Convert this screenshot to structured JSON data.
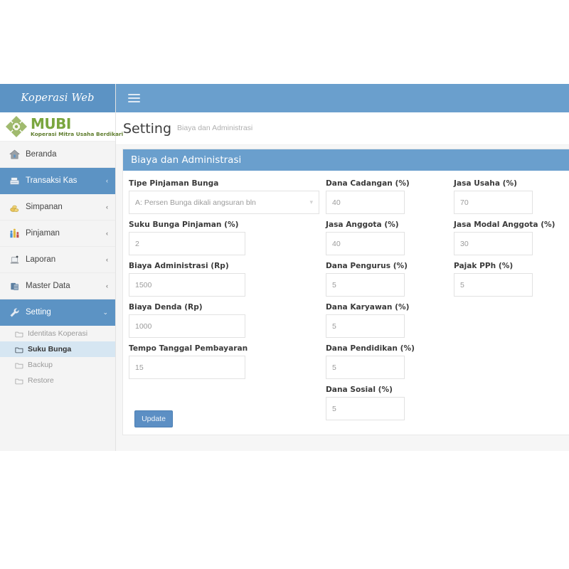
{
  "sidebar": {
    "brand": "Koperasi Web",
    "logo": {
      "icon": "mubi-diamond-logo",
      "word": "MUBI",
      "tagline": "Koperasi Mitra Usaha Berdikari",
      "color": "#7aa63f"
    },
    "items": [
      {
        "label": "Beranda",
        "icon": "home-icon",
        "caret": "",
        "active": false
      },
      {
        "label": "Transaksi Kas",
        "icon": "cash-register-icon",
        "caret": "‹",
        "active": true
      },
      {
        "label": "Simpanan",
        "icon": "money-bag-icon",
        "caret": "‹",
        "active": false
      },
      {
        "label": "Pinjaman",
        "icon": "people-chart-icon",
        "caret": "‹",
        "active": false
      },
      {
        "label": "Laporan",
        "icon": "report-icon",
        "caret": "‹",
        "active": false
      },
      {
        "label": "Master Data",
        "icon": "database-icon",
        "caret": "‹",
        "active": false
      },
      {
        "label": "Setting",
        "icon": "wrench-icon",
        "caret": "⌄",
        "active": true
      }
    ],
    "subitems": [
      {
        "label": "Identitas Koperasi",
        "icon": "folder-icon",
        "active": false
      },
      {
        "label": "Suku Bunga",
        "icon": "folder-icon",
        "active": true
      },
      {
        "label": "Backup",
        "icon": "folder-icon",
        "active": false
      },
      {
        "label": "Restore",
        "icon": "folder-icon",
        "active": false
      }
    ]
  },
  "topbar": {
    "menu_toggle": "hamburger-icon"
  },
  "page": {
    "title": "Setting",
    "breadcrumb": "Biaya dan Administrasi"
  },
  "panel": {
    "heading": "Biaya dan Administrasi",
    "col1": [
      {
        "label": "Tipe Pinjaman Bunga",
        "value": "A: Persen Bunga dikali angsuran bln",
        "type": "select"
      },
      {
        "label": "Suku Bunga Pinjaman (%)",
        "value": "2",
        "type": "text"
      },
      {
        "label": "Biaya Administrasi (Rp)",
        "value": "1500",
        "type": "text"
      },
      {
        "label": "Biaya Denda (Rp)",
        "value": "1000",
        "type": "text"
      },
      {
        "label": "Tempo Tanggal Pembayaran",
        "value": "15",
        "type": "text"
      }
    ],
    "col2": [
      {
        "label": "Dana Cadangan (%)",
        "value": "40",
        "type": "text"
      },
      {
        "label": "Jasa Anggota (%)",
        "value": "40",
        "type": "text"
      },
      {
        "label": "Dana Pengurus (%)",
        "value": "5",
        "type": "text"
      },
      {
        "label": "Dana Karyawan (%)",
        "value": "5",
        "type": "text"
      },
      {
        "label": "Dana Pendidikan (%)",
        "value": "5",
        "type": "text"
      },
      {
        "label": "Dana Sosial (%)",
        "value": "5",
        "type": "text"
      }
    ],
    "col3": [
      {
        "label": "Jasa Usaha (%)",
        "value": "70",
        "type": "text"
      },
      {
        "label": "Jasa Modal Anggota (%)",
        "value": "30",
        "type": "text"
      },
      {
        "label": "Pajak PPh (%)",
        "value": "5",
        "type": "text"
      }
    ],
    "update_button": "Update"
  },
  "colors": {
    "primary": "#6a9fcd",
    "sidebar_active": "#5c93c4",
    "submenu_active": "#d6e6f2",
    "sidebar_bg": "#f4f4f4",
    "button": "#5c8fc4",
    "logo_green": "#7aa63f"
  }
}
